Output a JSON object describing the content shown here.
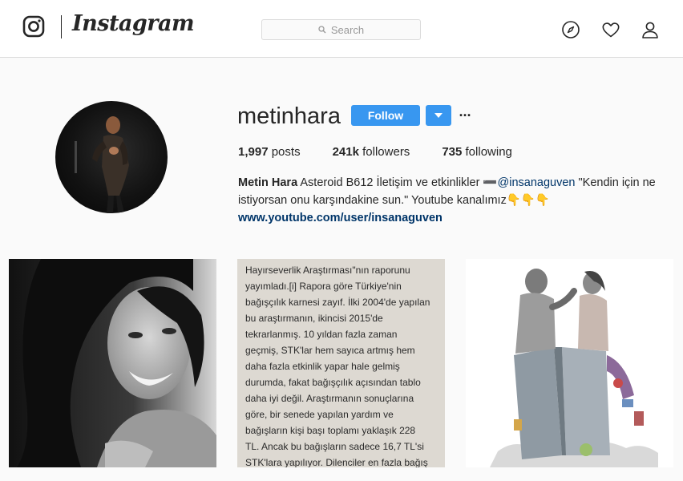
{
  "nav": {
    "logo_icon": "instagram-glyph-icon",
    "wordmark": "Instagram",
    "search_placeholder": "Search",
    "icons": [
      "compass-icon",
      "heart-icon",
      "user-icon"
    ]
  },
  "profile": {
    "username": "metinhara",
    "follow_label": "Follow",
    "more_glyph": "···",
    "stats": [
      {
        "value": "1,997",
        "label": "posts"
      },
      {
        "value": "241k",
        "label": "followers"
      },
      {
        "value": "735",
        "label": "following"
      }
    ],
    "bio": {
      "name": "Metin Hara",
      "text1": " Asteroid B612 İletişim ve etkinlikler ➖",
      "mention": "@insanaguven",
      "text2": " \"Kendin için ne istiyorsan onu karşındakine sun.\" Youtube kanalımız👇👇👇",
      "link": "www.youtube.com/user/insanaguven"
    }
  },
  "posts": {
    "text_post": "Hayırseverlik Araştırması\"nın raporunu\nyayımladı.[i] Rapora göre Türkiye'nin\nbağışçılık karnesi zayıf. İlki 2004'de yapılan\nbu araştırmanın, ikincisi 2015'de\ntekrarlanmış. 10 yıldan fazla zaman\ngeçmiş, STK'lar hem sayıca artmış hem\ndaha fazla etkinlik yapar hale gelmiş\ndurumda, fakat bağışçılık açısından tablo\ndaha iyi değil. Araştırmanın sonuçlarına\ngöre, bir senede yapılan yardım ve\nbağışların kişi başı toplamı yaklaşık 228\nTL. Ancak bu bağışların sadece 16,7 TL'si\nSTK'lara yapılıyor. Dilenciler en fazla bağış"
  },
  "colors": {
    "accent": "#3897f0",
    "text": "#262626",
    "link": "#003569",
    "background": "#fafafa"
  }
}
